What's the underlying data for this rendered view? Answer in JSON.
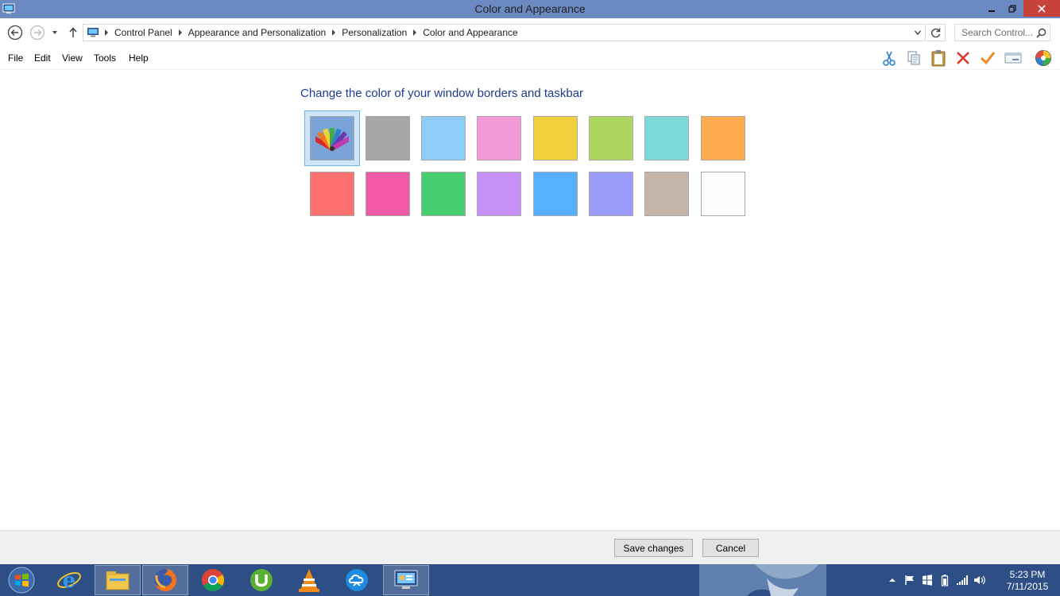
{
  "window": {
    "title": "Color and Appearance"
  },
  "address_bar": {
    "breadcrumbs": [
      "Control Panel",
      "Appearance and Personalization",
      "Personalization",
      "Color and Appearance"
    ],
    "search_placeholder": "Search Control..."
  },
  "menu": {
    "items": [
      "File",
      "Edit",
      "View",
      "Tools",
      "Help"
    ]
  },
  "toolbar": {
    "icons": [
      "scissors-icon",
      "copy-icon",
      "clipboard-icon",
      "delete-x-icon",
      "checkmark-icon",
      "window-icon",
      "color-wheel-icon"
    ]
  },
  "main": {
    "heading": "Change the color of your window borders and taskbar",
    "swatches": [
      {
        "name": "automatic",
        "color": "#7aa4d8",
        "selected": true
      },
      {
        "name": "gray",
        "color": "#a6a6a6"
      },
      {
        "name": "light-blue",
        "color": "#8ecdf8"
      },
      {
        "name": "pink",
        "color": "#f59ad8"
      },
      {
        "name": "yellow",
        "color": "#f0d03e"
      },
      {
        "name": "lime",
        "color": "#acd65e"
      },
      {
        "name": "teal",
        "color": "#7ad9d9"
      },
      {
        "name": "orange",
        "color": "#fdab4e"
      },
      {
        "name": "salmon",
        "color": "#fd7070"
      },
      {
        "name": "hot-pink",
        "color": "#f25aa8"
      },
      {
        "name": "green",
        "color": "#46cd6f"
      },
      {
        "name": "violet",
        "color": "#c690f8"
      },
      {
        "name": "blue",
        "color": "#55b0fd"
      },
      {
        "name": "periwinkle",
        "color": "#9b9bfb"
      },
      {
        "name": "taupe",
        "color": "#c4b5a8"
      },
      {
        "name": "white",
        "color": "#fbfbf9"
      }
    ]
  },
  "buttons": {
    "save": "Save changes",
    "cancel": "Cancel"
  },
  "taskbar": {
    "apps": [
      "internet-explorer-icon",
      "file-explorer-icon",
      "firefox-icon",
      "chrome-icon",
      "utorrent-icon",
      "vlc-icon",
      "cloud-sync-icon",
      "control-panel-icon"
    ],
    "time": "5:23 PM",
    "date": "7/11/2015"
  }
}
